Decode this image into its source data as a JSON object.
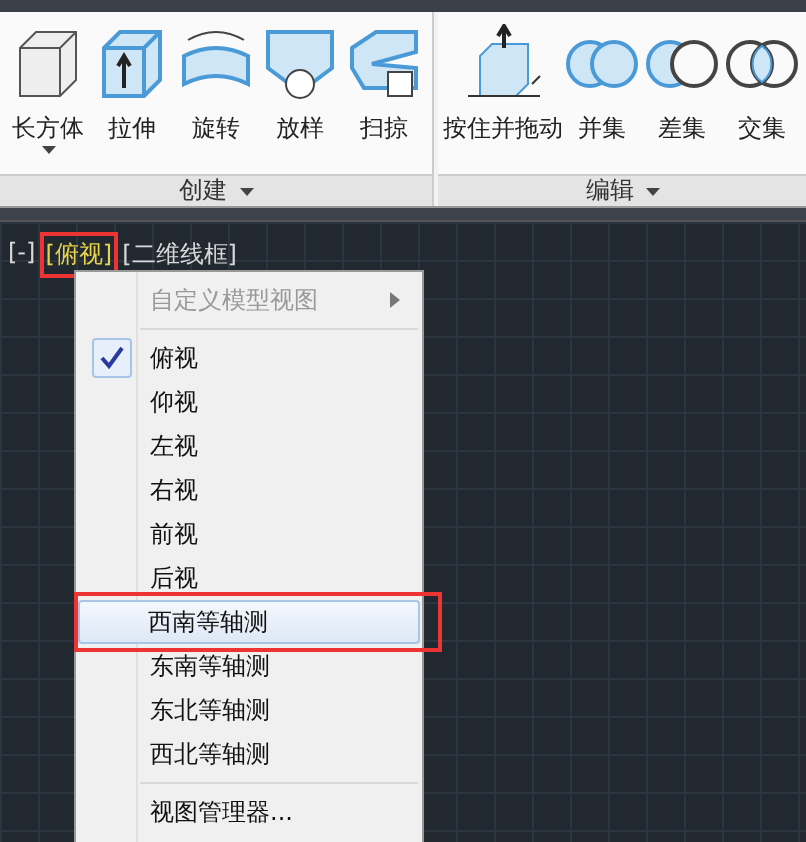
{
  "ribbon": {
    "panels": [
      {
        "title": "创建",
        "tools": [
          {
            "label": "长方体",
            "kind": "box",
            "dropdown": true
          },
          {
            "label": "拉伸",
            "kind": "extrude",
            "dropdown": false
          },
          {
            "label": "旋转",
            "kind": "revolve",
            "dropdown": false
          },
          {
            "label": "放样",
            "kind": "loft",
            "dropdown": false
          },
          {
            "label": "扫掠",
            "kind": "sweep",
            "dropdown": false
          }
        ]
      },
      {
        "title": "编辑",
        "tools": [
          {
            "label": "按住并拖动",
            "kind": "presspull",
            "dropdown": false
          },
          {
            "label": "并集",
            "kind": "union",
            "dropdown": false
          },
          {
            "label": "差集",
            "kind": "subtract",
            "dropdown": false
          },
          {
            "label": "交集",
            "kind": "intersect",
            "dropdown": false
          }
        ]
      }
    ]
  },
  "viewport": {
    "controls": [
      {
        "text": "[-]",
        "highlighted": false,
        "annotated": false
      },
      {
        "text": "[俯视]",
        "highlighted": true,
        "annotated": true
      },
      {
        "text": "[二维线框]",
        "highlighted": false,
        "annotated": false
      }
    ]
  },
  "menu": {
    "header": {
      "label": "自定义模型视图",
      "disabled": true
    },
    "views": [
      {
        "label": "俯视",
        "checked": true,
        "selected": false,
        "annotated": false
      },
      {
        "label": "仰视",
        "checked": false,
        "selected": false,
        "annotated": false
      },
      {
        "label": "左视",
        "checked": false,
        "selected": false,
        "annotated": false
      },
      {
        "label": "右视",
        "checked": false,
        "selected": false,
        "annotated": false
      },
      {
        "label": "前视",
        "checked": false,
        "selected": false,
        "annotated": false
      },
      {
        "label": "后视",
        "checked": false,
        "selected": false,
        "annotated": false
      },
      {
        "label": "西南等轴测",
        "checked": false,
        "selected": true,
        "annotated": true
      },
      {
        "label": "东南等轴测",
        "checked": false,
        "selected": false,
        "annotated": false
      },
      {
        "label": "东北等轴测",
        "checked": false,
        "selected": false,
        "annotated": false
      },
      {
        "label": "西北等轴测",
        "checked": false,
        "selected": false,
        "annotated": false
      }
    ],
    "footer": {
      "label": "视图管理器..."
    }
  }
}
